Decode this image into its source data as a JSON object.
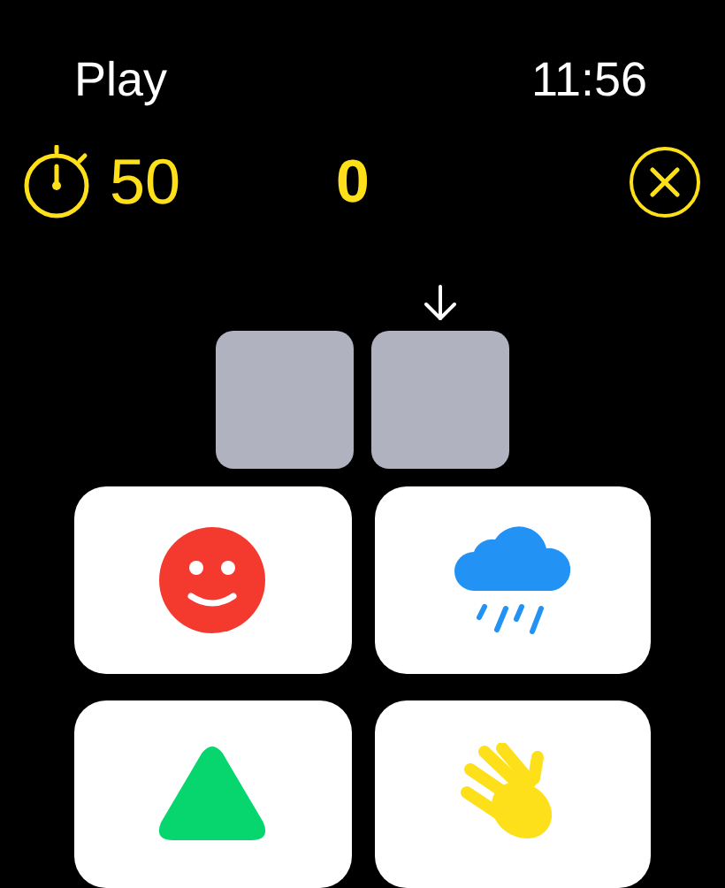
{
  "header": {
    "title": "Play",
    "time": "11:56"
  },
  "stats": {
    "timer": "50",
    "score": "0"
  },
  "slots": [
    {
      "current": false
    },
    {
      "current": true
    }
  ],
  "choices": [
    {
      "kind": "smiley"
    },
    {
      "kind": "rain"
    },
    {
      "kind": "triangle"
    },
    {
      "kind": "hand"
    }
  ]
}
